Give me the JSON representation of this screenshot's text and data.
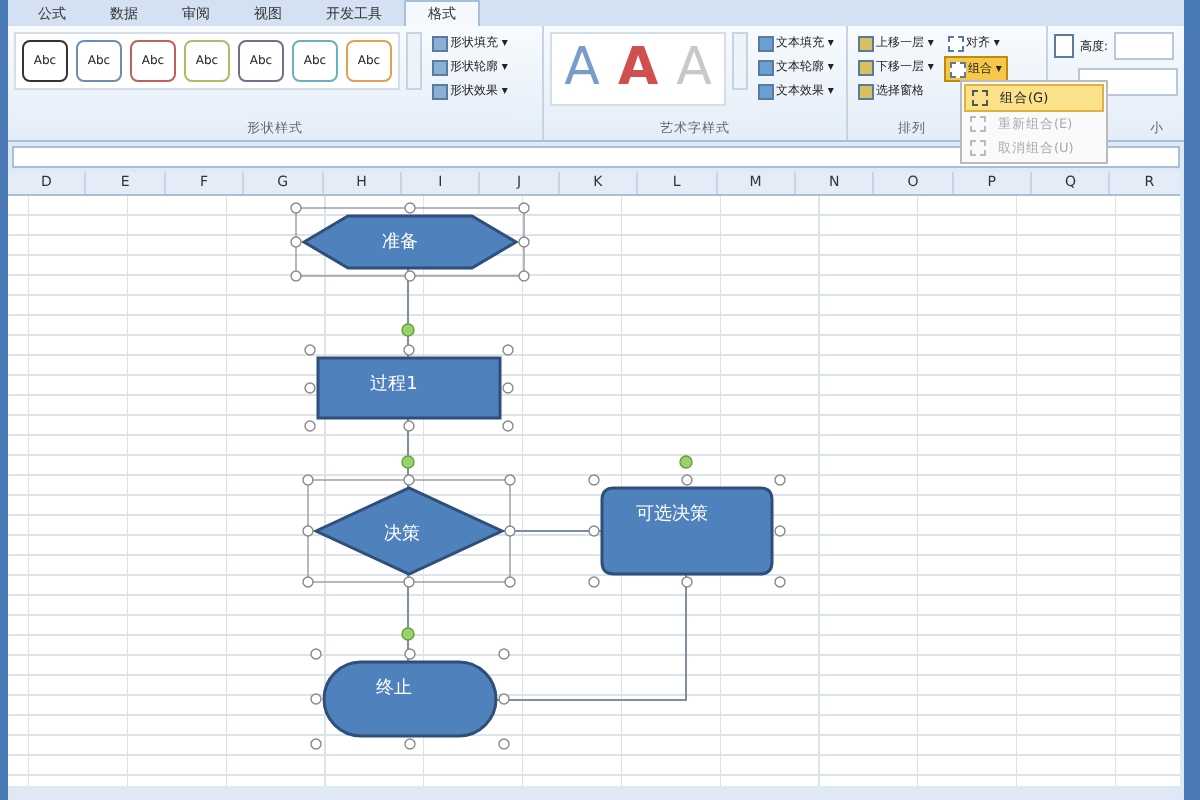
{
  "tabs": [
    {
      "label": "公式",
      "selected": false
    },
    {
      "label": "数据",
      "selected": false
    },
    {
      "label": "审阅",
      "selected": false
    },
    {
      "label": "视图",
      "selected": false
    },
    {
      "label": "开发工具",
      "selected": false
    },
    {
      "label": "格式",
      "selected": true
    }
  ],
  "ribbon": {
    "shape_styles": {
      "label": "形状样式",
      "gallery": [
        {
          "text": "Abc",
          "color": "#333333"
        },
        {
          "text": "Abc",
          "color": "#6a8fb5"
        },
        {
          "text": "Abc",
          "color": "#c0605a"
        },
        {
          "text": "Abc",
          "color": "#a8bf6a"
        },
        {
          "text": "Abc",
          "color": "#7a6a90"
        },
        {
          "text": "Abc",
          "color": "#6ab0c0"
        },
        {
          "text": "Abc",
          "color": "#e0a050"
        }
      ],
      "commands": [
        "形状填充 ▾",
        "形状轮廓 ▾",
        "形状效果 ▾"
      ]
    },
    "wordart_styles": {
      "label": "艺术字样式",
      "gallery": [
        {
          "text": "A",
          "kind": "outline",
          "color": "#7a9cc8"
        },
        {
          "text": "A",
          "kind": "filled",
          "color": "#d05050"
        },
        {
          "text": "A",
          "kind": "outline",
          "color": "#c8c8c8"
        }
      ],
      "commands": [
        "文本填充 ▾",
        "文本轮廓 ▾",
        "文本效果 ▾"
      ]
    },
    "arrange": {
      "label": "排列",
      "commands": [
        "上移一层 ▾",
        "下移一层 ▾",
        "选择窗格"
      ],
      "align": "对齐 ▾",
      "group": {
        "label": "组合 ▾",
        "selected": true
      }
    },
    "size": {
      "label": "小",
      "height_label": "高度:"
    }
  },
  "group_menu": [
    {
      "label": "组合(G)",
      "disabled": false,
      "selected": true
    },
    {
      "label": "重新组合(E)",
      "disabled": true,
      "selected": false
    },
    {
      "label": "取消组合(U)",
      "disabled": true,
      "selected": false
    }
  ],
  "columns": [
    "D",
    "E",
    "F",
    "G",
    "H",
    "I",
    "J",
    "K",
    "L",
    "M",
    "N",
    "O",
    "P",
    "Q",
    "R"
  ],
  "flowchart": {
    "nodes": [
      {
        "kind": "hexagon",
        "text": "准备"
      },
      {
        "kind": "rect",
        "text": "过程1"
      },
      {
        "kind": "diamond",
        "text": "决策"
      },
      {
        "kind": "rounded",
        "text": "可选决策"
      },
      {
        "kind": "terminator",
        "text": "终止"
      }
    ]
  }
}
